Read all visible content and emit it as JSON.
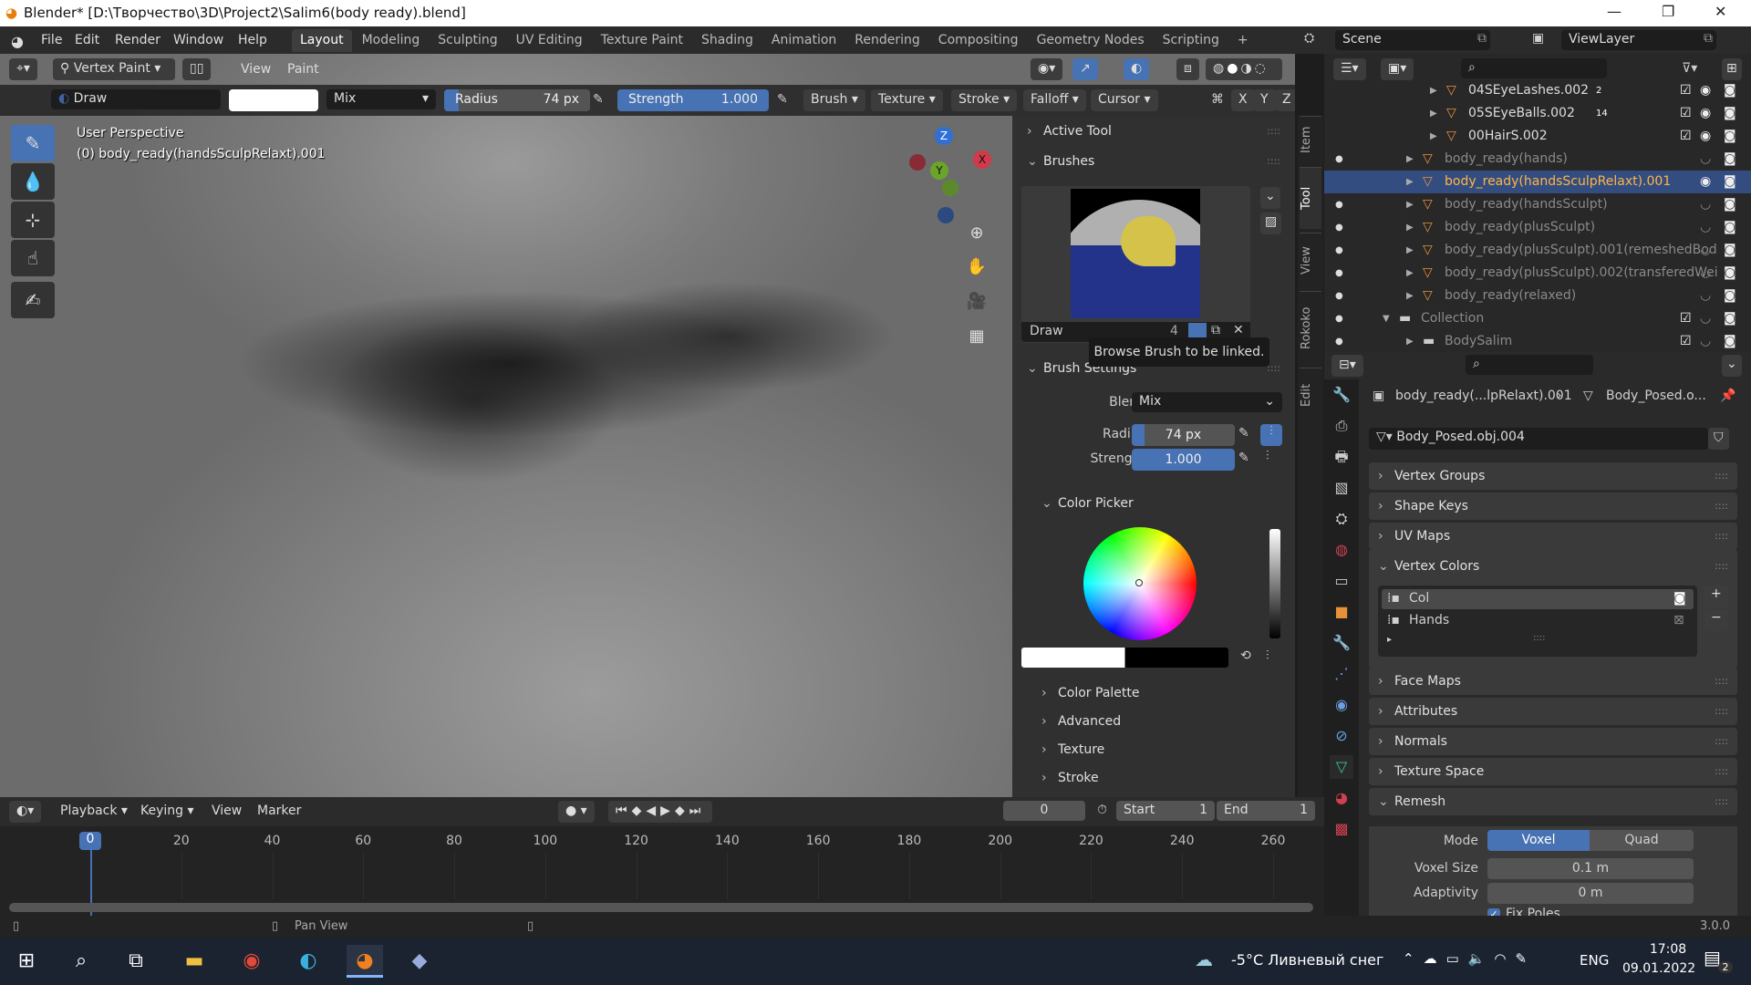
{
  "window": {
    "title": "Blender* [D:\\Творчество\\3D\\Project2\\Salim6(body ready).blend]"
  },
  "menu": [
    "File",
    "Edit",
    "Render",
    "Window",
    "Help"
  ],
  "workspaces": [
    {
      "label": "Layout",
      "active": true
    },
    {
      "label": "Modeling"
    },
    {
      "label": "Sculpting"
    },
    {
      "label": "UV Editing"
    },
    {
      "label": "Texture Paint"
    },
    {
      "label": "Shading"
    },
    {
      "label": "Animation"
    },
    {
      "label": "Rendering"
    },
    {
      "label": "Compositing"
    },
    {
      "label": "Geometry Nodes"
    },
    {
      "label": "Scripting"
    },
    {
      "label": "+"
    }
  ],
  "scene": {
    "name": "Scene",
    "view_layer": "ViewLayer"
  },
  "viewport_header": {
    "mode": "Vertex Paint",
    "view": "View",
    "paint": "Paint"
  },
  "tool_settings": {
    "brush": "Draw",
    "blend": "Mix",
    "radius_label": "Radius",
    "radius_value": "74 px",
    "radius_fraction": 0.1,
    "strength_label": "Strength",
    "strength_value": "1.000",
    "strength_fraction": 1.0,
    "dropdowns": [
      "Brush",
      "Texture",
      "Stroke",
      "Falloff",
      "Cursor"
    ],
    "axes": [
      "X",
      "Y",
      "Z"
    ],
    "brush_color": "#ffffff"
  },
  "viewport": {
    "perspective": "User Perspective",
    "object": "(0) body_ready(handsSculpRelaxt).001",
    "gizmo": {
      "z": "Z",
      "y": "Y",
      "x": "X"
    }
  },
  "sidebar_tabs": [
    {
      "label": "Item"
    },
    {
      "label": "Tool",
      "active": true
    },
    {
      "label": "View"
    },
    {
      "label": "Rokoko"
    },
    {
      "label": "Edit"
    }
  ],
  "npanel": {
    "active_tool": "Active Tool",
    "brushes": "Brushes",
    "brush_name": "Draw",
    "brush_users": "4",
    "tooltip": "Browse Brush to be linked.",
    "brush_settings": "Brush Settings",
    "blend_label": "Blend",
    "blend_value": "Mix",
    "radius_label": "Radius",
    "radius_value": "74 px",
    "strength_label": "Strength",
    "strength_value": "1.000",
    "color_picker": "Color Picker",
    "collapsed": [
      "Color Palette",
      "Advanced",
      "Texture",
      "Stroke"
    ]
  },
  "outliner": {
    "rows": [
      {
        "name": "04SEyeLashes.002",
        "badge": "2",
        "indent": 3
      },
      {
        "name": "05SEyeBalls.002",
        "badge": "14",
        "indent": 3
      },
      {
        "name": "00HairS.002",
        "indent": 3
      },
      {
        "name": "body_ready(hands)",
        "indent": 2,
        "dim": true
      },
      {
        "name": "body_ready(handsSculpRelaxt).001",
        "indent": 2,
        "selected": true
      },
      {
        "name": "body_ready(handsSculpt)",
        "indent": 2,
        "dim": true
      },
      {
        "name": "body_ready(plusSculpt)",
        "indent": 2,
        "dim": true
      },
      {
        "name": "body_ready(plusSculpt).001(remeshedBod",
        "indent": 2,
        "dim": true
      },
      {
        "name": "body_ready(plusSculpt).002(transferedWei",
        "indent": 2,
        "dim": true
      },
      {
        "name": "body_ready(relaxed)",
        "indent": 2,
        "dim": true
      },
      {
        "name": "Collection",
        "indent": 1,
        "dim": true,
        "collection": true
      },
      {
        "name": "BodySalim",
        "indent": 2,
        "dim": true,
        "collection": true
      }
    ]
  },
  "properties": {
    "breadcrumb_object": "body_ready(...lpRelaxt).001",
    "breadcrumb_data": "Body_Posed.o...",
    "mesh_name": "Body_Posed.obj.004",
    "panels_top": [
      "Vertex Groups",
      "Shape Keys",
      "UV Maps"
    ],
    "vertex_colors": {
      "title": "Vertex Colors",
      "items": [
        "Col",
        "Hands"
      ]
    },
    "panels_bottom": [
      "Face Maps",
      "Attributes",
      "Normals",
      "Texture Space"
    ],
    "remesh": {
      "title": "Remesh",
      "mode_label": "Mode",
      "mode_options": [
        "Voxel",
        "Quad"
      ],
      "voxel_size_label": "Voxel Size",
      "voxel_size": "0.1 m",
      "adaptivity_label": "Adaptivity",
      "adaptivity": "0 m",
      "fix_poles": "Fix Poles"
    }
  },
  "timeline": {
    "menus": [
      "Playback",
      "Keying",
      "View",
      "Marker"
    ],
    "current_frame": "0",
    "start_label": "Start",
    "start": "1",
    "end_label": "End",
    "end": "1",
    "ticks": [
      "0",
      "20",
      "40",
      "60",
      "80",
      "100",
      "120",
      "140",
      "160",
      "180",
      "200",
      "220",
      "240",
      "260"
    ]
  },
  "statusbar": {
    "hint": "Pan View",
    "version": "3.0.0"
  },
  "taskbar": {
    "weather": "-5°C  Ливневый снег",
    "lang": "ENG",
    "time": "17:08",
    "date": "09.01.2022",
    "notifications": "2"
  },
  "colors": {
    "accent": "#4772b3",
    "selected_row": "#334d80",
    "object_orange": "#e8913a",
    "mesh_green": "#3fc79a"
  }
}
